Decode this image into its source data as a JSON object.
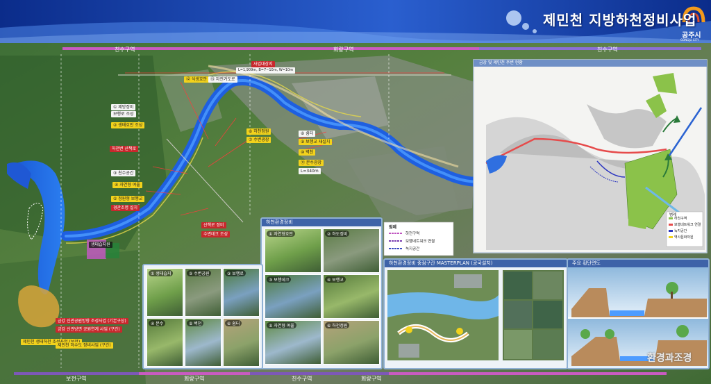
{
  "header": {
    "title": "제민천 지방하천정비사업",
    "logo_text": "공주시",
    "logo_subtext": "GONGJU CITY"
  },
  "sections_top": [
    "친수구역",
    "회랑구역",
    "친수구역"
  ],
  "sections_bottom": [
    "보전구역",
    "회랑구역",
    "친수구역",
    "회랑구역"
  ],
  "map_labels": {
    "top_box": "사업대상지",
    "top_box_sub": "L=1,909m, B=7~10m, W=10m",
    "ecology_zone": "생태습지원"
  },
  "callouts": [
    {
      "text": "① 제방정비",
      "color": "white"
    },
    {
      "text": "보행로 조성",
      "color": "white"
    },
    {
      "text": "② 생태호안 조성",
      "color": "yellow"
    },
    {
      "text": "하천변 산책로",
      "color": "red"
    },
    {
      "text": "③ 친수공간",
      "color": "white"
    },
    {
      "text": "④ 자연형 여울",
      "color": "yellow"
    },
    {
      "text": "⑤ 정원형 보행교",
      "color": "yellow"
    },
    {
      "text": "경관조명 설치",
      "color": "red"
    },
    {
      "text": "⑥ 하천정원",
      "color": "yellow"
    },
    {
      "text": "⑦ 수변광장",
      "color": "yellow"
    },
    {
      "text": "⑧ 쉼터",
      "color": "white"
    },
    {
      "text": "⑨ 보행교 재설치",
      "color": "yellow"
    },
    {
      "text": "⑩ 벽천",
      "color": "yellow"
    },
    {
      "text": "⑪ 분수광장",
      "color": "yellow"
    },
    {
      "text": "L=340m",
      "color": "white"
    },
    {
      "text": "산책로 정비",
      "color": "red"
    },
    {
      "text": "수변데크 조성",
      "color": "red"
    },
    {
      "text": "⑫ 식생호안",
      "color": "yellow"
    },
    {
      "text": "⑬ 자전거도로",
      "color": "white"
    }
  ],
  "bottom_callouts": [
    {
      "text": "금강 신관공원방향 조성사업 (기본구상)",
      "color": "red"
    },
    {
      "text": "제민천 생태하천 조성사업 (보전)",
      "color": "yellow"
    },
    {
      "text": "금강 신관방면 공원연계 사업 (구간)",
      "color": "red"
    },
    {
      "text": "제민천 하수도 정비사업 (구간)",
      "color": "yellow"
    }
  ],
  "inset_map": {
    "title": "금강 및 제민천 주변 현황",
    "legend_title": "범례",
    "legend": [
      "하천구역",
      "보행네트워크 연결",
      "녹지공간",
      "역사문화자원"
    ]
  },
  "photo_panel_1": {
    "title": "하천환경정비",
    "items": [
      "① 자연형호안",
      "② 하도정비",
      "③ 보행데크",
      "④ 보행교",
      "⑤ 자연형 여울",
      "⑥ 하천정원"
    ]
  },
  "photo_panel_2": {
    "items": [
      "① 생태습지",
      "② 수변공원",
      "③ 보행로",
      "④ 분수",
      "⑤ 벽천",
      "⑥ 쉼터"
    ]
  },
  "plan_panel": {
    "title": "하천환경정비 중점구간 MASTERPLAN (공국설치)"
  },
  "section_panel": {
    "title": "주요 횡단면도"
  },
  "watermark": "환경과조경"
}
